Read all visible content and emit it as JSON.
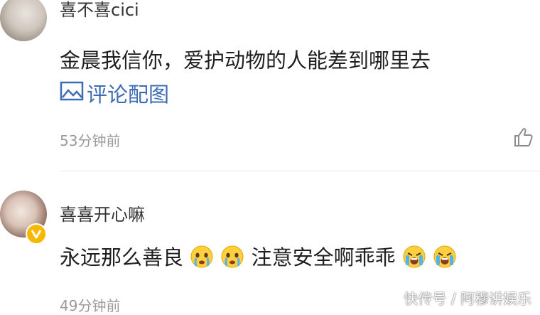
{
  "comments": [
    {
      "username": "喜不喜cici",
      "content": "金晨我信你，爱护动物的人能差到哪里去",
      "picture_link": "评论配图",
      "time": "53分钟前"
    },
    {
      "username": "喜喜开心嘛",
      "content_parts": [
        "永远那么善良",
        "注意安全啊乖乖"
      ],
      "time": "49分钟前",
      "verified": true
    }
  ],
  "watermark": "快传号 / 阿穆讲娱乐",
  "icons": {
    "picture": "image-icon",
    "like": "thumb-up-icon",
    "verified": "verified-v-badge-icon",
    "emoji_crying": "crying-face-icon",
    "emoji_sob": "sob-face-icon"
  },
  "colors": {
    "link": "#3e6cb4",
    "time": "#9a9a9a",
    "badge": "#f6b800"
  }
}
